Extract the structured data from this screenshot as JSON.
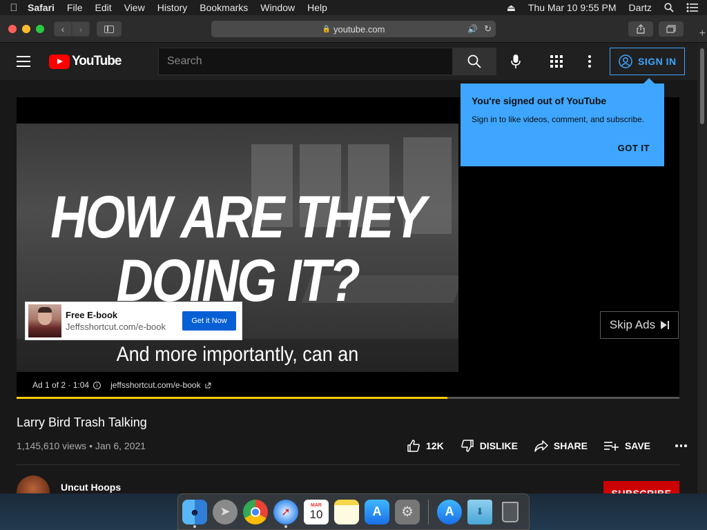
{
  "menubar": {
    "apple_icon": "apple-icon",
    "items": [
      "Safari",
      "File",
      "Edit",
      "View",
      "History",
      "Bookmarks",
      "Window",
      "Help"
    ],
    "datetime": "Thu Mar 10  9:55 PM",
    "user": "Dartz"
  },
  "safari": {
    "url": "youtube.com"
  },
  "youtube": {
    "logo_text": "YouTube",
    "search_placeholder": "Search",
    "sign_in_label": "SIGN IN",
    "tooltip": {
      "title": "You're signed out of YouTube",
      "body": "Sign in to like videos, comment, and subscribe.",
      "got_it": "GOT IT"
    },
    "player": {
      "overlay_line1": "HOW ARE THEY",
      "overlay_line2": "DOING IT?",
      "caption": "And more importantly, can an",
      "ad_card_title": "Free E-book",
      "ad_card_url": "Jeffsshortcut.com/e-book",
      "ad_card_cta": "Get it Now",
      "skip_label": "Skip Ads",
      "ad_info": "Ad 1 of 2 · 1:04",
      "ad_link": "jeffsshortcut.com/e-book",
      "progress_fraction": 0.65,
      "progress_color": "#ffcc00"
    },
    "video": {
      "title": "Larry Bird Trash Talking",
      "meta": "1,145,610 views • Jan 6, 2021",
      "likes": "12K",
      "dislike_label": "DISLIKE",
      "share_label": "SHARE",
      "save_label": "SAVE"
    },
    "channel": {
      "name": "Uncut Hoops",
      "subscribe_label": "SUBSCRIBE"
    }
  },
  "dock": {
    "apps": [
      "finder-icon",
      "launchpad-icon",
      "chrome-icon",
      "safari-icon",
      "calendar-icon",
      "notes-icon",
      "app-store-icon",
      "system-preferences-icon",
      "app-store-icon",
      "downloads-folder-icon",
      "trash-icon"
    ],
    "calendar_month": "MAR",
    "calendar_day": "10"
  },
  "colors": {
    "youtube_red": "#ff0000",
    "accent_blue": "#3ea6ff",
    "cta_blue": "#065fd4",
    "subscribe_red": "#cc0000"
  }
}
